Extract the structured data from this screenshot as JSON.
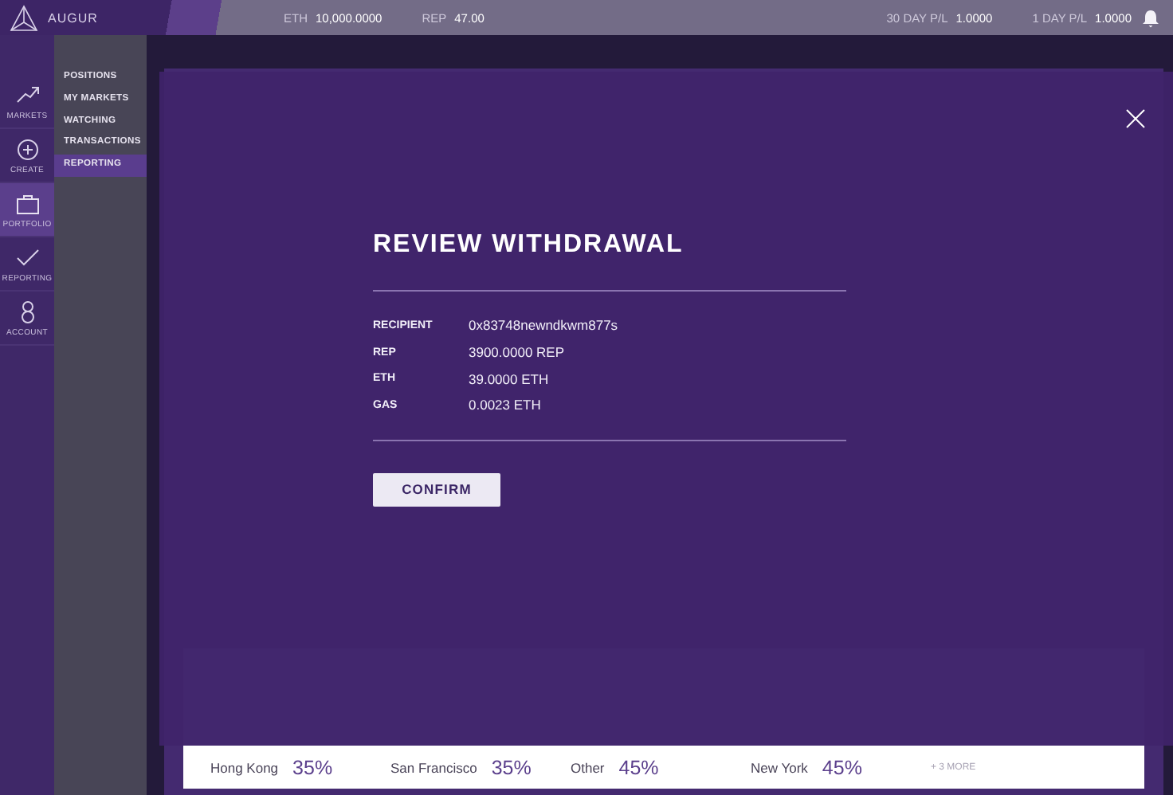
{
  "header": {
    "logo": "AUGUR",
    "stats": [
      {
        "label": "ETH",
        "value": "10,000.0000"
      },
      {
        "label": "REP",
        "value": "47.00"
      },
      {
        "label": "30 DAY P/L",
        "value": "1.0000"
      },
      {
        "label": "1 DAY P/L",
        "value": "1.0000"
      }
    ]
  },
  "sidebar": {
    "items": [
      {
        "label": "MARKETS",
        "selected": false
      },
      {
        "label": "CREATE",
        "selected": false
      },
      {
        "label": "PORTFOLIO",
        "selected": true
      },
      {
        "label": "REPORTING",
        "selected": false
      },
      {
        "label": "ACCOUNT",
        "selected": false
      }
    ]
  },
  "submenu": {
    "items": [
      {
        "label": "POSITIONS",
        "selected": false
      },
      {
        "label": "MY MARKETS",
        "selected": false
      },
      {
        "label": "WATCHING",
        "selected": false
      },
      {
        "label": "TRANSACTIONS",
        "selected": false
      },
      {
        "label": "REPORTING",
        "selected": true
      }
    ]
  },
  "market_card": {
    "outcomes": [
      {
        "name": "Hong Kong",
        "percent": "35%"
      },
      {
        "name": "San Francisco",
        "percent": "35%"
      },
      {
        "name": "Other",
        "percent": "45%"
      },
      {
        "name": "New York",
        "percent": "45%"
      }
    ],
    "more": "+ 3 MORE"
  },
  "modal": {
    "title": "REVIEW WITHDRAWAL",
    "rows": [
      {
        "label": "RECIPIENT",
        "value": "0x83748newndkwm877s"
      },
      {
        "label": "REP",
        "value": "3900.0000 REP"
      },
      {
        "label": "ETH",
        "value": "39.0000 ETH"
      },
      {
        "label": "GAS",
        "value": "0.0023 ETH"
      }
    ],
    "button": "CONFIRM"
  }
}
